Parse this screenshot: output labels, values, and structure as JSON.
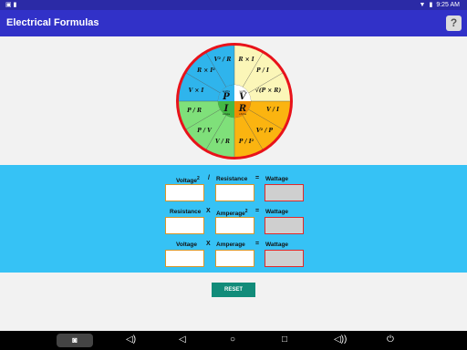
{
  "status": {
    "time": "9:25 AM"
  },
  "header": {
    "title": "Electrical Formulas",
    "help_label": "?"
  },
  "wheel": {
    "center": [
      {
        "var": "P",
        "unit": "watts"
      },
      {
        "var": "V",
        "unit": "volts"
      },
      {
        "var": "I",
        "unit": "amps"
      },
      {
        "var": "R",
        "unit": "ohms"
      }
    ],
    "formulas": [
      "R × I",
      "P / I",
      "√(P × R)",
      "V / I",
      "V² / P",
      "P / I²",
      "V / R",
      "P / V",
      "P / R",
      "V × I",
      "R × I²",
      "V² / R"
    ]
  },
  "calculator": {
    "rows": [
      {
        "a": "Voltage",
        "a_sup": "2",
        "op": "/",
        "b": "Resistance",
        "b_sup": "",
        "eq": "=",
        "result": "Wattage"
      },
      {
        "a": "Resistance",
        "a_sup": "",
        "op": "X",
        "b": "Amperage",
        "b_sup": "2",
        "eq": "=",
        "result": "Wattage"
      },
      {
        "a": "Voltage",
        "a_sup": "",
        "op": "X",
        "b": "Amperage",
        "b_sup": "",
        "eq": "=",
        "result": "Wattage"
      }
    ],
    "reset_label": "RESET"
  },
  "nav": {
    "icons": [
      "camera-icon",
      "volume-down-icon",
      "back-icon",
      "home-icon",
      "recents-icon",
      "volume-up-icon",
      "power-icon"
    ]
  },
  "colors": {
    "statusbar": "#2b2aa6",
    "appbar": "#3131c8",
    "panel": "#36c2f5",
    "reset": "#128c7a",
    "field_border": "#d8962a",
    "result_border": "#e02a2a",
    "ring": "#e8121a"
  }
}
